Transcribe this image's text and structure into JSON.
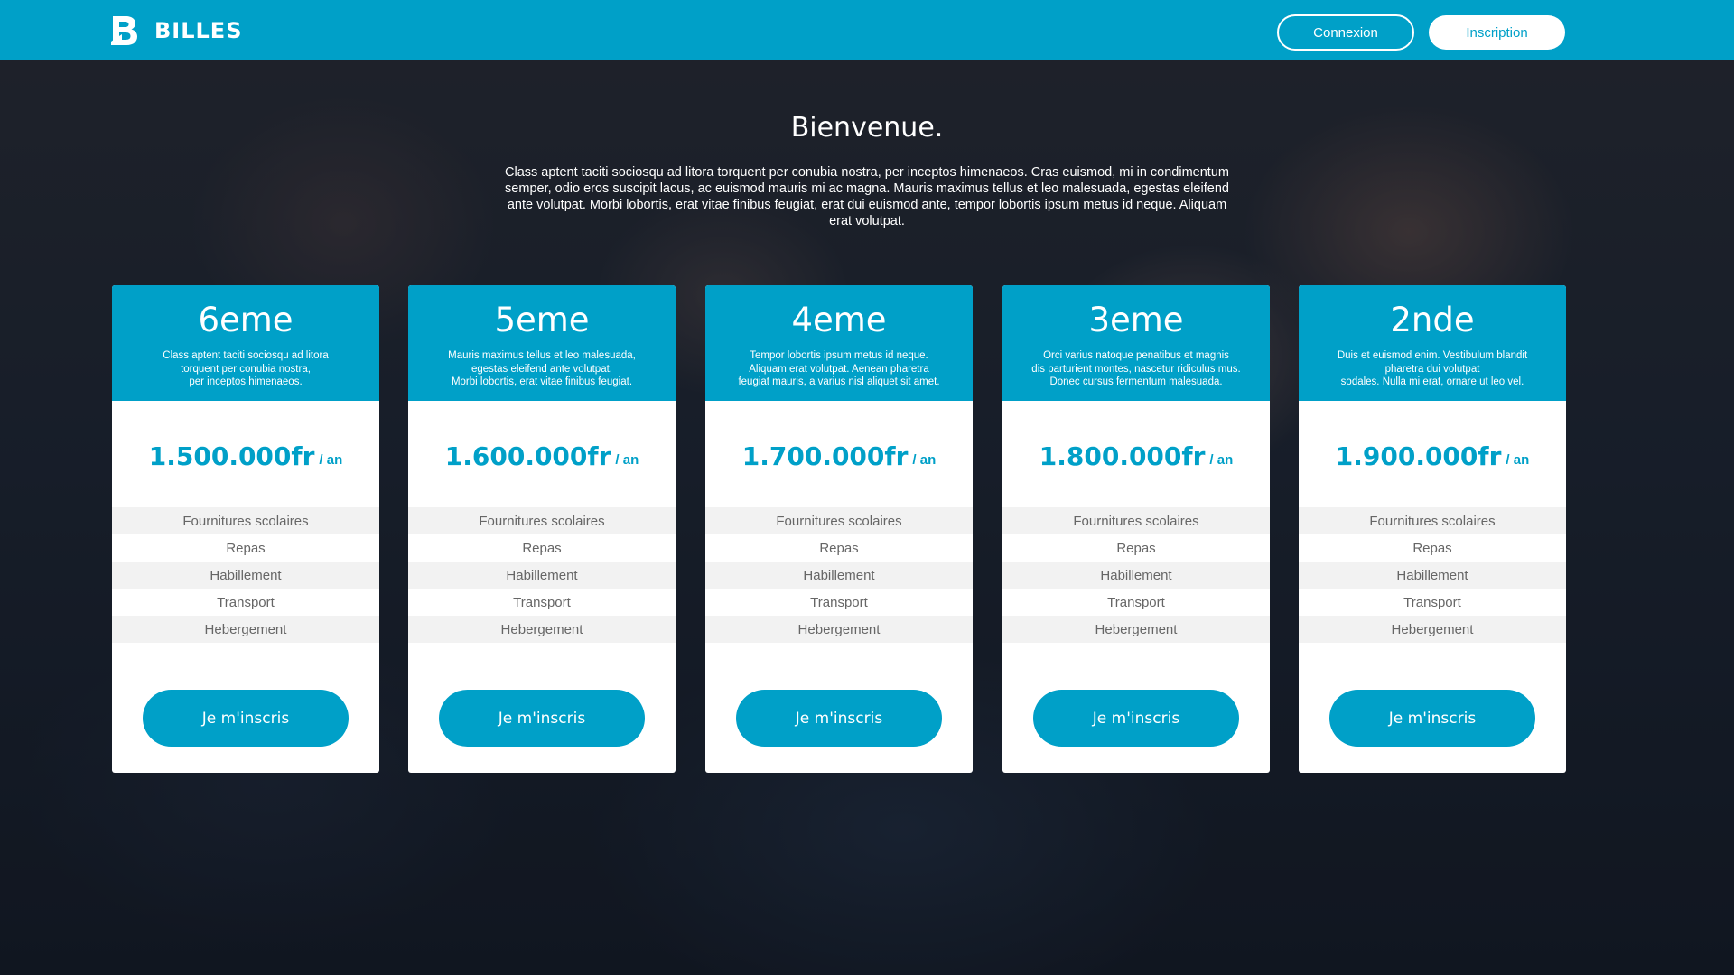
{
  "brand": {
    "name": "BILLES",
    "color": "#00a0c8"
  },
  "header": {
    "login_label": "Connexion",
    "signup_label": "Inscription"
  },
  "hero": {
    "title": "Bienvenue.",
    "text": "Class aptent taciti sociosqu ad litora torquent per conubia nostra, per inceptos himenaeos. Cras euismod, mi in condimentum semper, odio eros suscipit lacus, ac euismod mauris mi ac magna. Mauris maximus tellus et leo malesuada, egestas eleifend ante volutpat. Morbi lobortis, erat vitae finibus feugiat, erat dui euismod ante, tempor lobortis ipsum metus id neque. Aliquam erat volutpat."
  },
  "plans": [
    {
      "name": "6eme",
      "desc": "Class aptent taciti sociosqu ad litora\ntorquent per conubia nostra,\nper inceptos himenaeos.",
      "price": "1.500.000fr",
      "period": "/ an",
      "features": [
        "Fournitures scolaires",
        "Repas",
        "Habillement",
        "Transport",
        "Hebergement"
      ],
      "cta": "Je m'inscris"
    },
    {
      "name": "5eme",
      "desc": "Mauris maximus tellus et leo malesuada,\negestas eleifend ante volutpat.\nMorbi lobortis, erat vitae finibus feugiat.",
      "price": "1.600.000fr",
      "period": "/ an",
      "features": [
        "Fournitures scolaires",
        "Repas",
        "Habillement",
        "Transport",
        "Hebergement"
      ],
      "cta": "Je m'inscris"
    },
    {
      "name": "4eme",
      "desc": "Tempor lobortis ipsum metus id neque.\nAliquam erat volutpat. Aenean pharetra\nfeugiat mauris, a varius nisl aliquet sit amet.",
      "price": "1.700.000fr",
      "period": "/ an",
      "features": [
        "Fournitures scolaires",
        "Repas",
        "Habillement",
        "Transport",
        "Hebergement"
      ],
      "cta": "Je m'inscris"
    },
    {
      "name": "3eme",
      "desc": "Orci varius natoque penatibus et magnis\ndis parturient montes, nascetur ridiculus mus.\nDonec cursus fermentum malesuada.",
      "price": "1.800.000fr",
      "period": "/ an",
      "features": [
        "Fournitures scolaires",
        "Repas",
        "Habillement",
        "Transport",
        "Hebergement"
      ],
      "cta": "Je m'inscris"
    },
    {
      "name": "2nde",
      "desc": "Duis et euismod enim. Vestibulum blandit\npharetra dui volutpat\nsodales. Nulla mi erat, ornare ut leo vel.",
      "price": "1.900.000fr",
      "period": "/ an",
      "features": [
        "Fournitures scolaires",
        "Repas",
        "Habillement",
        "Transport",
        "Hebergement"
      ],
      "cta": "Je m'inscris"
    }
  ]
}
